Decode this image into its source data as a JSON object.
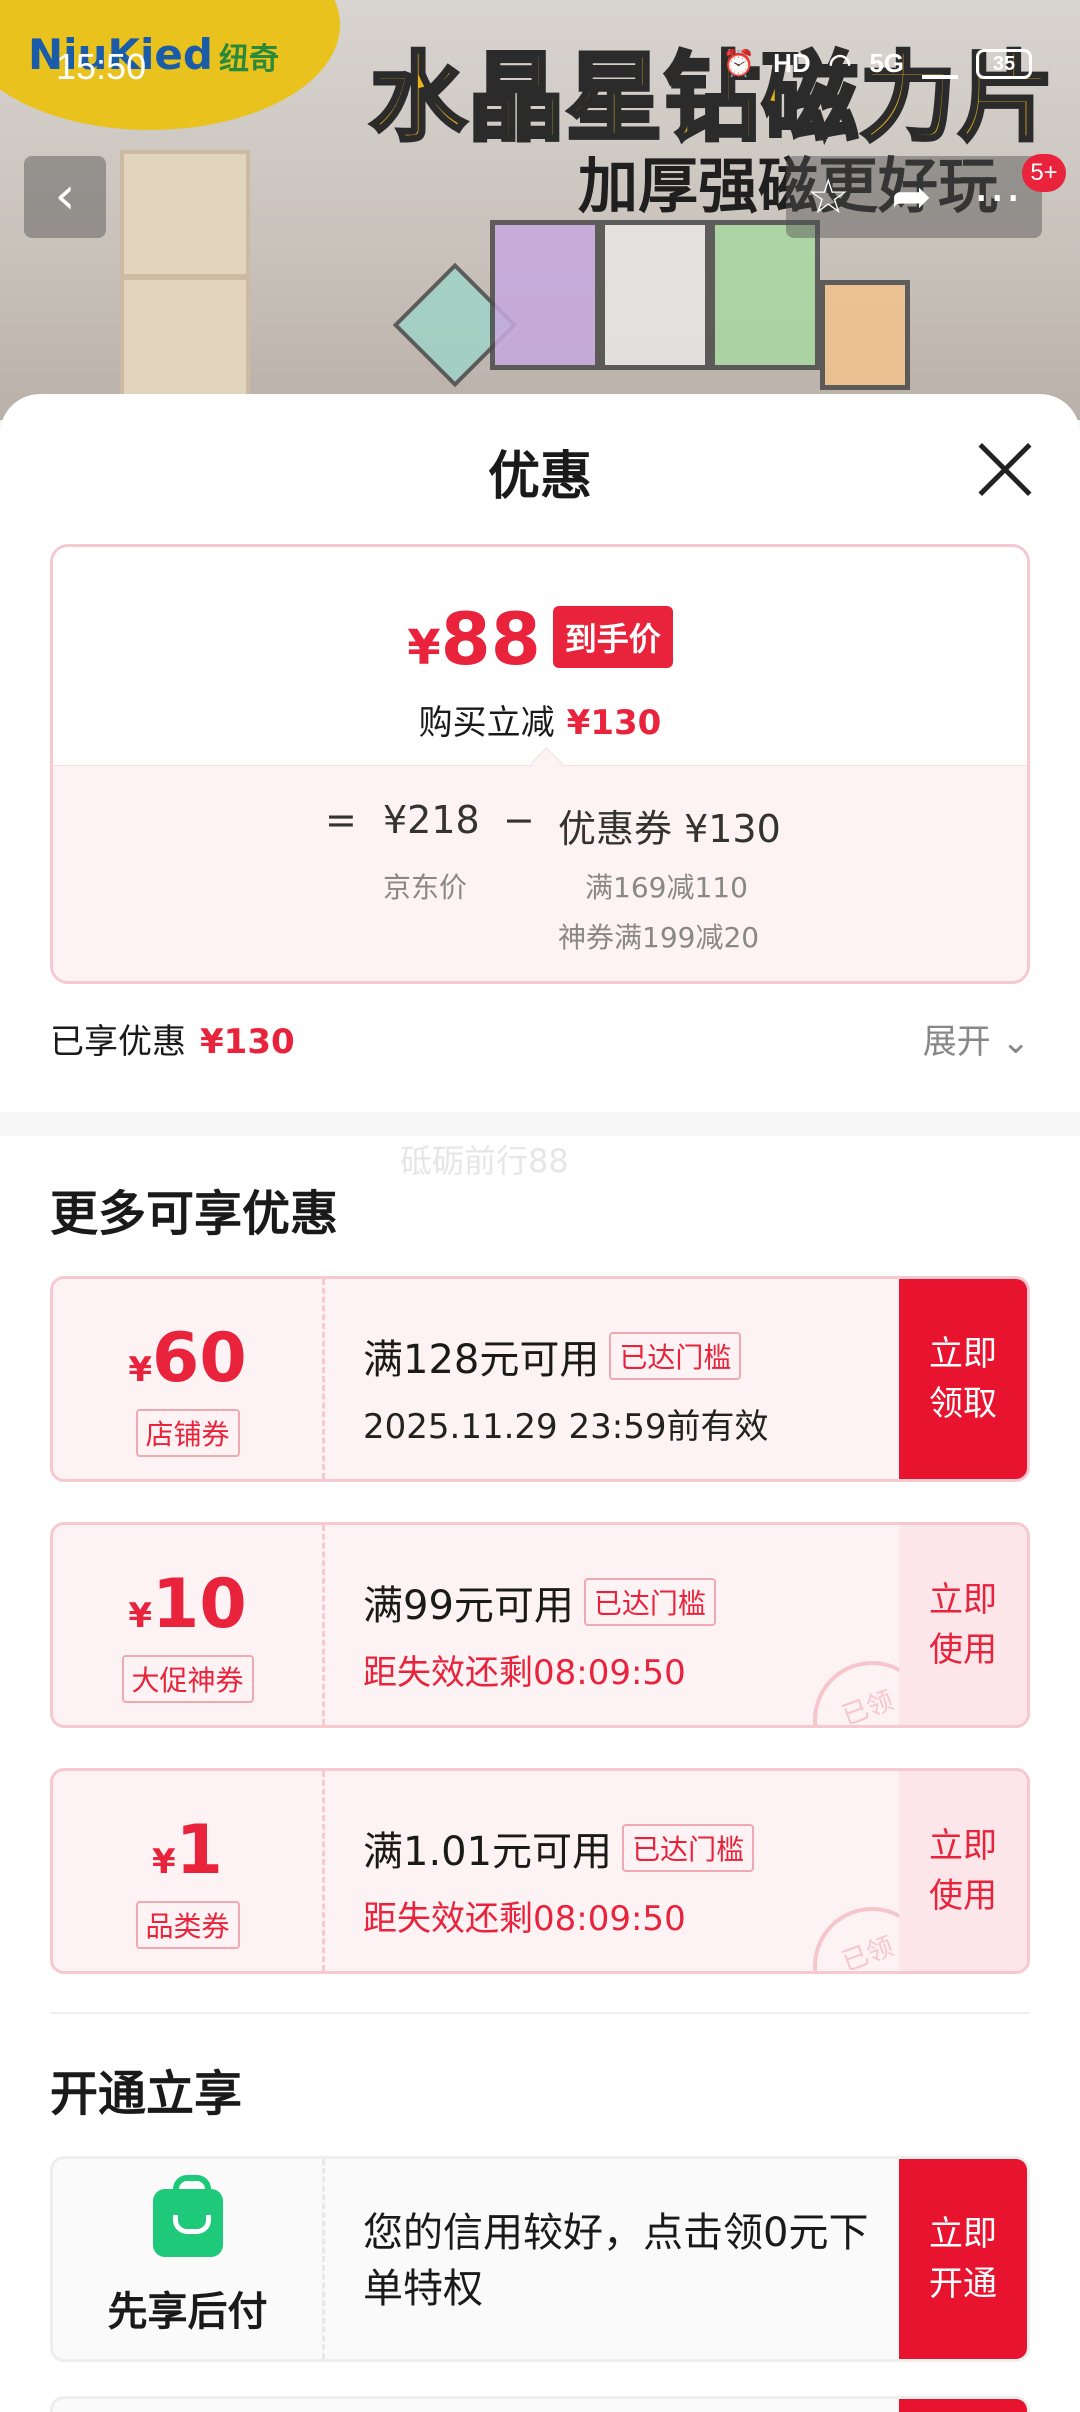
{
  "status_bar": {
    "time": "15:50",
    "network": "5G",
    "battery": "35"
  },
  "background": {
    "logo": "NiuKied",
    "logo_cn": "纽奇",
    "headline": "水晶星钻磁力片",
    "subhead": "加厚强磁更好玩"
  },
  "nav": {
    "badge": "5+"
  },
  "sheet": {
    "title": "优惠",
    "price": {
      "currency": "¥",
      "value": "88",
      "tag": "到手价",
      "reduce_label": "购买立减",
      "reduce_amount": "¥130"
    },
    "formula": {
      "eq": "=",
      "base": "¥218",
      "minus": "−",
      "coupon_label": "优惠券 ¥130",
      "base_caption": "京东价",
      "rule1": "满169减110",
      "rule2": "神券满199减20"
    },
    "enjoyed": {
      "label": "已享优惠",
      "amount": "¥130",
      "expand": "展开"
    },
    "watermark": "砥砺前行88",
    "more_title": "更多可享优惠",
    "coupons": [
      {
        "currency": "¥",
        "value": "60",
        "type": "店铺券",
        "condition": "满128元可用",
        "badge": "已达门槛",
        "validity": "2025.11.29 23:59前有效",
        "button": "立即\n领取"
      },
      {
        "currency": "¥",
        "value": "10",
        "type": "大促神券",
        "condition": "满99元可用",
        "badge": "已达门槛",
        "validity": "距失效还剩08:09:50",
        "button": "立即\n使用",
        "stamp": "已领"
      },
      {
        "currency": "¥",
        "value": "1",
        "type": "品类券",
        "condition": "满1.01元可用",
        "badge": "已达门槛",
        "validity": "距失效还剩08:09:50",
        "button": "立即\n使用",
        "stamp": "已领"
      }
    ],
    "open_title": "开通立享",
    "pay_later": {
      "name": "先享后付",
      "desc": "您的信用较好，点击领0元下单特权",
      "button": "立即\n开通"
    }
  }
}
